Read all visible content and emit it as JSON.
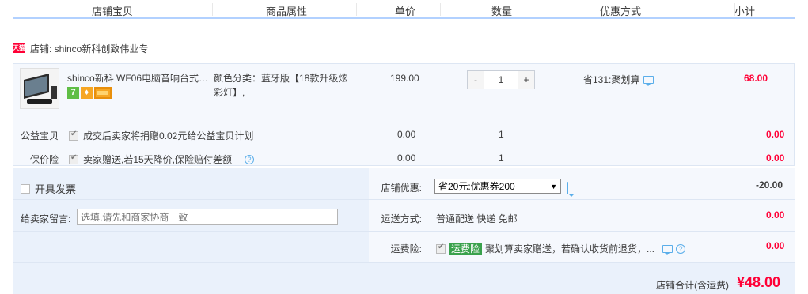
{
  "header": {
    "columns": [
      "店铺宝贝",
      "商品属性",
      "单价",
      "数量",
      "优惠方式",
      "小计"
    ]
  },
  "shop": {
    "badge": "天猫",
    "label": "店铺: shinco新科创致伟业专"
  },
  "item": {
    "title": "shinco新科 WF06电脑音响台式…",
    "badge_7": "7",
    "attr": "颜色分类：蓝牙版【18款升级炫彩灯】,",
    "price": "199.00",
    "qty_minus": "-",
    "qty_plus": "+",
    "quantity": "1",
    "discount": "省131:聚划算",
    "subtotal": "68.00"
  },
  "charity": {
    "label": "公益宝贝",
    "desc": "成交后卖家将捐赠0.02元给公益宝贝计划",
    "price": "0.00",
    "qty": "1",
    "subtotal": "0.00"
  },
  "price_protect": {
    "label": "保价险",
    "desc": "卖家赠送,若15天降价,保险赔付差额",
    "help": "?",
    "price": "0.00",
    "qty": "1",
    "subtotal": "0.00"
  },
  "invoice": {
    "label": "开具发票"
  },
  "message": {
    "label": "给卖家留言:",
    "placeholder": "选填,请先和商家协商一致"
  },
  "shop_discount": {
    "label": "店铺优惠:",
    "selected": "省20元:优惠券200",
    "arrow": "▼",
    "value": "-20.00"
  },
  "shipping": {
    "label": "运送方式:",
    "value": "普通配送 快递 免邮",
    "fee": "0.00"
  },
  "freight_insurance": {
    "label": "运费险:",
    "tag": "运费险",
    "desc": "聚划算卖家赠送，若确认收货前退货，...",
    "help": "?",
    "fee": "0.00"
  },
  "total": {
    "label": "店铺合计(含运费)",
    "value": "¥48.00"
  }
}
